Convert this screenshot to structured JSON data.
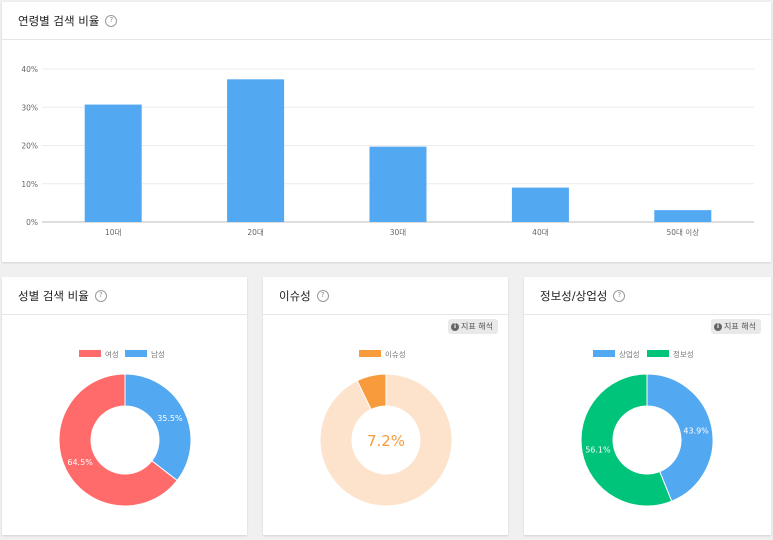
{
  "age_card": {
    "title": "연령별 검색 비율",
    "help_symbol": "?"
  },
  "gender_card": {
    "title": "성별 검색 비율",
    "help_symbol": "?"
  },
  "issue_card": {
    "title": "이슈성",
    "help_symbol": "?",
    "info_label": "지표 해석",
    "info_symbol": "i"
  },
  "info_card": {
    "title": "정보성/상업성",
    "help_symbol": "?",
    "info_label": "지표 해석",
    "info_symbol": "i"
  },
  "chart_data": [
    {
      "type": "bar",
      "categories": [
        "10대",
        "20대",
        "30대",
        "40대",
        "50대 이상"
      ],
      "values": [
        30.7,
        37.3,
        19.7,
        9.0,
        3.1
      ],
      "ylim": [
        0,
        40
      ],
      "yticks": [
        "0%",
        "10%",
        "20%",
        "30%",
        "40%"
      ],
      "grid": true,
      "colors": {
        "bar": "#53a8f2"
      }
    },
    {
      "type": "pie",
      "donut": true,
      "legend_position": "top",
      "slices": [
        {
          "name": "여성",
          "value": 64.5,
          "label": "64.5%",
          "color": "#ff6b6b"
        },
        {
          "name": "남성",
          "value": 35.5,
          "label": "35.5%",
          "color": "#53a8f2"
        }
      ],
      "legend_order": [
        "여성",
        "남성"
      ]
    },
    {
      "type": "pie",
      "donut": true,
      "legend_position": "top",
      "center_label": "7.2%",
      "slices": [
        {
          "name": "이슈성",
          "value": 7.2,
          "label": "",
          "color": "#f79b3c"
        },
        {
          "name": "",
          "value": 92.8,
          "label": "",
          "color": "#fde3cc"
        }
      ],
      "legend_order": [
        "이슈성"
      ],
      "colors": {
        "center_text": "#f79b3c"
      }
    },
    {
      "type": "pie",
      "donut": true,
      "legend_position": "top",
      "slices": [
        {
          "name": "정보성",
          "value": 56.1,
          "label": "56.1%",
          "color": "#00c47a"
        },
        {
          "name": "상업성",
          "value": 43.9,
          "label": "43.9%",
          "color": "#53a8f2"
        }
      ],
      "legend_order": [
        "상업성",
        "정보성"
      ]
    }
  ]
}
